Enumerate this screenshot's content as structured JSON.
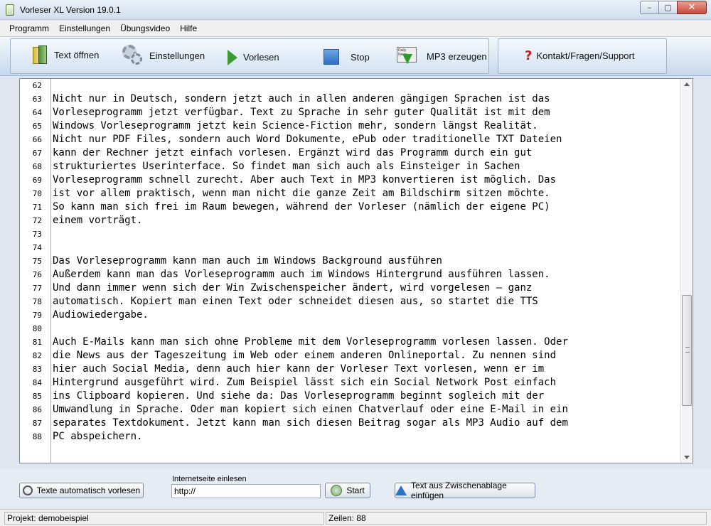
{
  "window": {
    "title": "Vorleser XL Version 19.0.1",
    "minimize_glyph": "–",
    "maximize_glyph": "▢",
    "close_glyph": "✕"
  },
  "menu": [
    "Programm",
    "Einstellungen",
    "Übungsvideo",
    "Hilfe"
  ],
  "toolbar": {
    "open_text": "Text öffnen",
    "settings": "Einstellungen",
    "read": "Vorlesen",
    "stop": "Stop",
    "mp3": "MP3 erzeugen",
    "support": "Kontakt/Fragen/Support",
    "support_icon_glyph": "?",
    "mp3_icon_text": "Daily News",
    "icons": {
      "open_text": "book-icon",
      "settings": "gear-icon",
      "read": "play-icon",
      "stop": "stop-icon",
      "mp3": "newspaper-download-icon",
      "support": "question-icon"
    }
  },
  "editor": {
    "lines": [
      {
        "n": "62",
        "text": ""
      },
      {
        "n": "63",
        "text": "Nicht nur in Deutsch, sondern jetzt auch in allen anderen gängigen Sprachen ist das"
      },
      {
        "n": "64",
        "text": "Vorleseprogramm jetzt verfügbar. Text zu Sprache in sehr guter Qualität ist mit dem"
      },
      {
        "n": "65",
        "text": "Windows Vorleseprogramm jetzt kein Science-Fiction mehr, sondern längst Realität."
      },
      {
        "n": "66",
        "text": "Nicht nur PDF Files, sondern auch Word Dokumente, ePub oder traditionelle TXT Dateien"
      },
      {
        "n": "67",
        "text": "kann der Rechner jetzt einfach vorlesen. Ergänzt wird das Programm durch ein gut"
      },
      {
        "n": "68",
        "text": "strukturiertes Userinterface. So findet man sich auch als Einsteiger in Sachen"
      },
      {
        "n": "69",
        "text": "Vorleseprogramm schnell zurecht. Aber auch Text in MP3 konvertieren ist möglich. Das"
      },
      {
        "n": "70",
        "text": "ist vor allem praktisch, wenn man nicht die ganze Zeit am Bildschirm sitzen möchte."
      },
      {
        "n": "71",
        "text": "So kann man sich frei im Raum bewegen, während der Vorleser (nämlich der eigene PC)"
      },
      {
        "n": "72",
        "text": "einem vorträgt."
      },
      {
        "n": "73",
        "text": ""
      },
      {
        "n": "74",
        "text": ""
      },
      {
        "n": "75",
        "text": "Das Vorleseprogramm kann man auch im Windows Background ausführen"
      },
      {
        "n": "76",
        "text": "Außerdem kann man das Vorleseprogramm auch im Windows Hintergrund ausführen lassen."
      },
      {
        "n": "77",
        "text": "Und dann immer wenn sich der Win Zwischenspeicher ändert, wird vorgelesen – ganz"
      },
      {
        "n": "78",
        "text": "automatisch. Kopiert man einen Text oder schneidet diesen aus, so startet die TTS"
      },
      {
        "n": "79",
        "text": "Audiowiedergabe."
      },
      {
        "n": "80",
        "text": ""
      },
      {
        "n": "81",
        "text": "Auch E-Mails kann man sich ohne Probleme mit dem Vorleseprogramm vorlesen lassen. Oder"
      },
      {
        "n": "82",
        "text": "die News aus der Tageszeitung im Web oder einem anderen Onlineportal. Zu nennen sind"
      },
      {
        "n": "83",
        "text": "hier auch Social Media, denn auch hier kann der Vorleser Text vorlesen, wenn er im"
      },
      {
        "n": "84",
        "text": "Hintergrund ausgeführt wird. Zum Beispiel lässt sich ein Social Network Post einfach"
      },
      {
        "n": "85",
        "text": "ins Clipboard kopieren. Und siehe da: Das Vorleseprogramm beginnt sogleich mit der"
      },
      {
        "n": "86",
        "text": "Umwandlung in Sprache. Oder man kopiert sich einen Chatverlauf oder eine E-Mail in ein"
      },
      {
        "n": "87",
        "text": "separates Textdokument. Jetzt kann man sich diesen Beitrag sogar als MP3 Audio auf dem"
      },
      {
        "n": "88",
        "text": "PC abspeichern."
      }
    ],
    "scroll_position": 0.82
  },
  "bottom": {
    "auto_read_button": "Texte automatisch vorlesen",
    "url_label": "Internetseite einlesen",
    "url_value": "http://",
    "start_button": "Start",
    "clipboard_button": "Text aus Zwischenablage einfügen"
  },
  "status": {
    "project": "Projekt: demobeispiel",
    "lines": "Zeilen: 88"
  },
  "colors": {
    "accent_blue": "#2c6fc1",
    "play_green": "#3c9a2e",
    "support_red": "#d01818"
  }
}
